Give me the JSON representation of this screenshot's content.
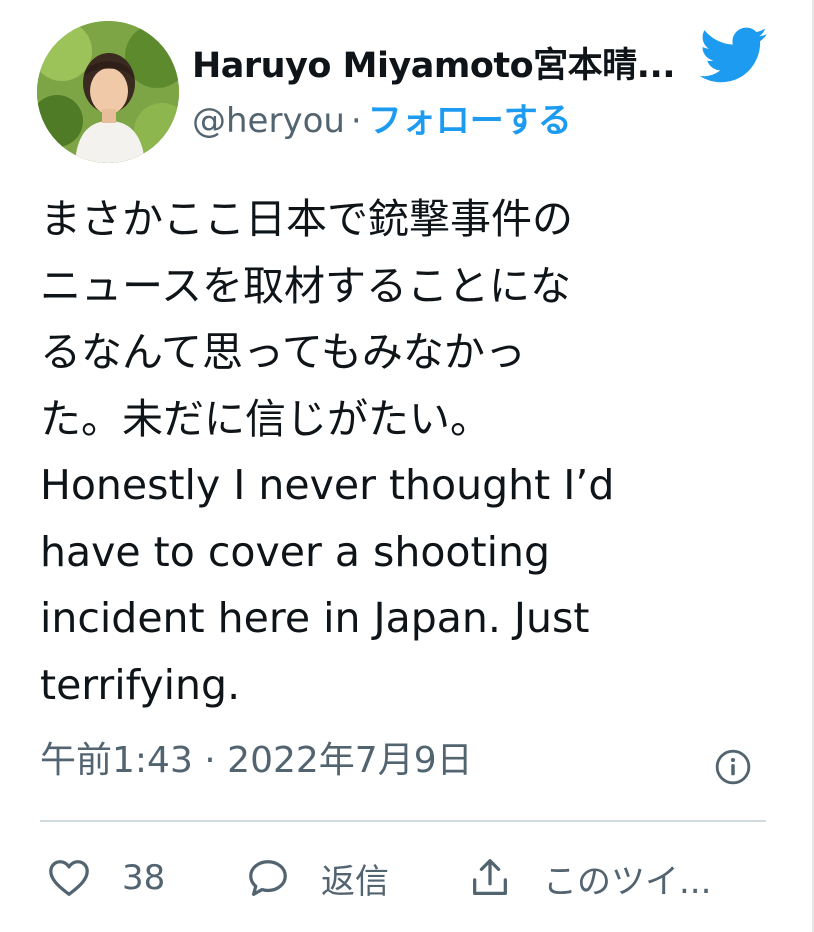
{
  "author": {
    "display_name": "Haruyo Miyamoto宮本晴...",
    "handle": "@heryou",
    "separator": "·",
    "follow_label": "フォローする"
  },
  "tweet": {
    "text": "まさかここ日本で銃撃事件の\nニュースを取材することにな\nるなんて思ってもみなかっ\nた。未だに信じがたい。\nHonestly I never thought I’d\nhave to cover a shooting\nincident here in Japan. Just\nterrifying.",
    "timestamp": "午前1:43 · 2022年7月9日"
  },
  "actions": {
    "like_count": "38",
    "reply_label": "返信",
    "share_label": "このツイ..."
  },
  "icons": {
    "brand": "twitter-bird-icon",
    "info": "info-icon",
    "like": "heart-icon",
    "reply": "speech-bubble-icon",
    "share": "share-icon"
  },
  "colors": {
    "accent": "#1d9bf0",
    "text": "#0f1419",
    "secondary": "#536471",
    "divider": "#cfd9de"
  }
}
